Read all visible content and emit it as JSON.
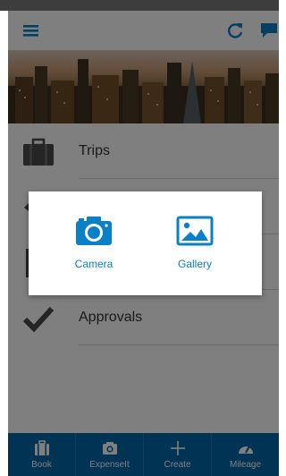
{
  "app": {
    "icons": {
      "menu": "hamburger-menu-icon",
      "refresh": "refresh-icon",
      "chat": "chat-bubble-icon"
    },
    "accent_color": "#0a80c6",
    "nav_color": "#0066a8"
  },
  "list": {
    "items": [
      {
        "label": "Trips",
        "icon": "briefcase-icon"
      },
      {
        "label": "",
        "icon": "tag-icon"
      },
      {
        "label": "",
        "icon": "document-icon"
      },
      {
        "label": "Approvals",
        "icon": "checkmark-icon"
      }
    ]
  },
  "dialog": {
    "options": [
      {
        "label": "Camera",
        "icon": "camera-icon"
      },
      {
        "label": "Gallery",
        "icon": "image-icon"
      }
    ]
  },
  "bottom_nav": {
    "items": [
      {
        "label": "Book",
        "icon": "briefcase-icon"
      },
      {
        "label": "ExpenseIt",
        "icon": "camera-icon"
      },
      {
        "label": "Create",
        "icon": "plus-icon"
      },
      {
        "label": "Mileage",
        "icon": "speedometer-icon"
      }
    ]
  }
}
